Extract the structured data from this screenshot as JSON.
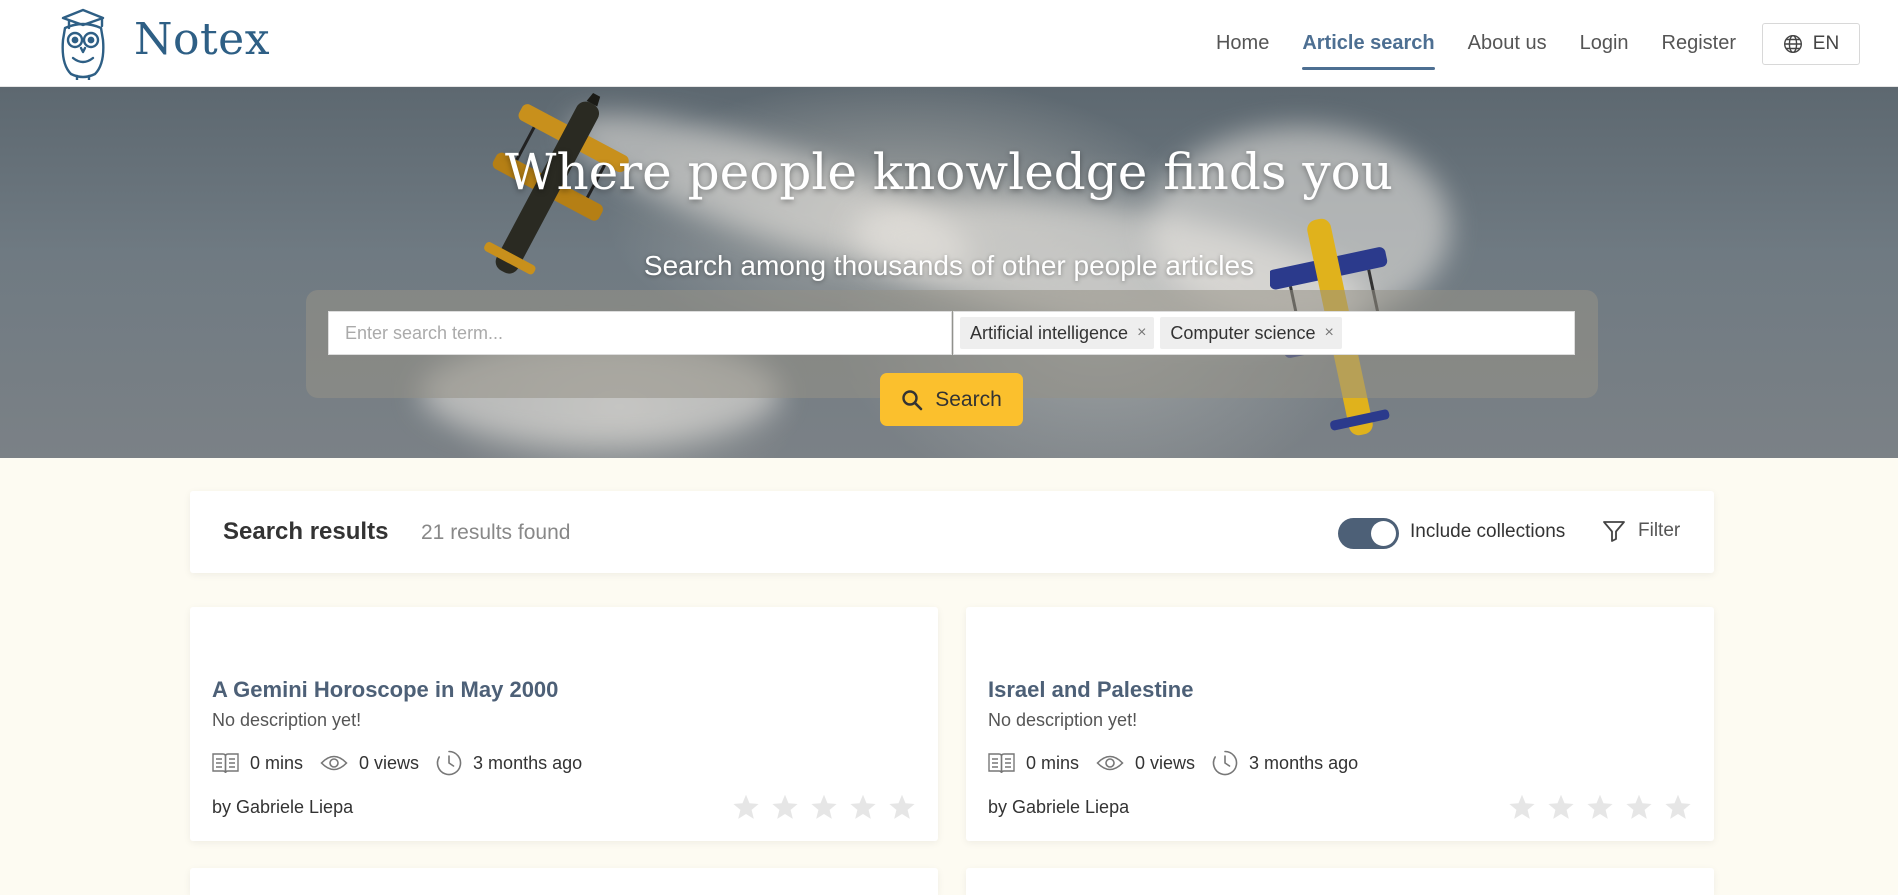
{
  "brand": {
    "name": "Notex"
  },
  "nav": {
    "links": [
      "Home",
      "Article search",
      "About us",
      "Login",
      "Register"
    ],
    "active": "Article search",
    "language": "EN"
  },
  "hero": {
    "title": "Where people knowledge finds you",
    "subtitle": "Search among thousands of other people articles",
    "search_placeholder": "Enter search term...",
    "search_value": "",
    "tags": [
      "Artificial intelligence",
      "Computer science"
    ],
    "search_button": "Search"
  },
  "results": {
    "title": "Search results",
    "count_text": "21 results found",
    "include_collections_label": "Include collections",
    "include_collections_on": true,
    "filter_label": "Filter"
  },
  "articles": [
    {
      "title": "A Gemini Horoscope in May 2000",
      "description": "No description yet!",
      "read_time": "0 mins",
      "views": "0 views",
      "age": "3 months ago",
      "author": "by Gabriele Liepa",
      "rating": 0
    },
    {
      "title": "Israel and Palestine",
      "description": "No description yet!",
      "read_time": "0 mins",
      "views": "0 views",
      "age": "3 months ago",
      "author": "by Gabriele Liepa",
      "rating": 0
    }
  ],
  "colors": {
    "brand": "#2e5f85",
    "accent": "#4d6077",
    "search_button": "#fbc02d",
    "page_bg": "#fdfbf2"
  }
}
